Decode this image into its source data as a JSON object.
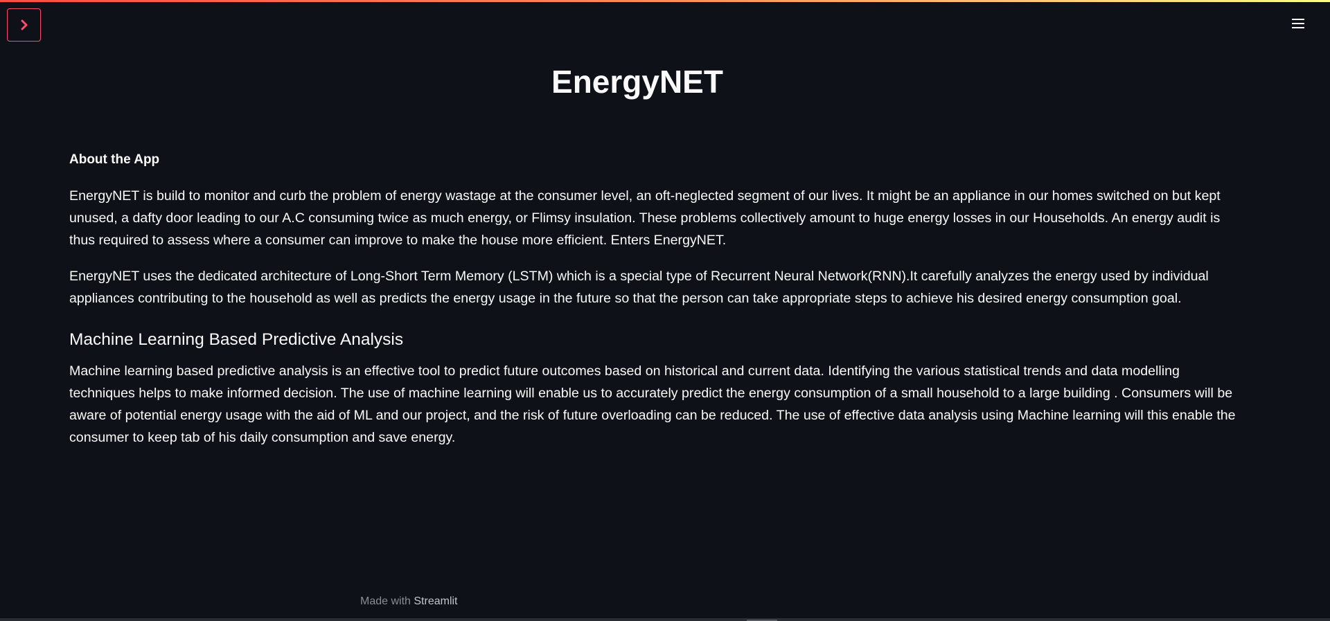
{
  "header": {
    "sidebar_toggle_icon": "chevron-right-icon",
    "menu_icon": "hamburger-menu-icon",
    "accent_color": "#ff4b6e"
  },
  "main": {
    "title": "EnergyNET",
    "about_heading": "About the App",
    "paragraph_1": "EnergyNET is build to monitor and curb the problem of energy wastage at the consumer level, an oft-neglected segment of our lives. It might be an appliance in our homes switched on but kept unused, a dafty door leading to our A.C consuming twice as much energy, or Flimsy insulation. These problems collectively amount to huge energy losses in our Households. An energy audit is thus required to assess where a consumer can improve to make the house more efficient. Enters EnergyNET.",
    "paragraph_2": "EnergyNET uses the dedicated architecture of Long-Short Term Memory (LSTM) which is a special type of Recurrent Neural Network(RNN).It carefully analyzes the energy used by individual appliances contributing to the household as well as predicts the energy usage in the future so that the person can take appropriate steps to achieve his desired energy consumption goal.",
    "ml_heading": "Machine Learning Based Predictive Analysis",
    "paragraph_3": "Machine learning based predictive analysis is an effective tool to predict future outcomes based on historical and current data. Identifying the various statistical trends and data modelling techniques helps to make informed decision. The use of machine learning will enable us to accurately predict the energy consumption of a small household to a large building . Consumers will be aware of potential energy usage with the aid of ML and our project, and the risk of future overloading can be reduced. The use of effective data analysis using Machine learning will this enable the consumer to keep tab of his daily consumption and save energy."
  },
  "footer": {
    "prefix": "Made with",
    "brand": "Streamlit"
  }
}
